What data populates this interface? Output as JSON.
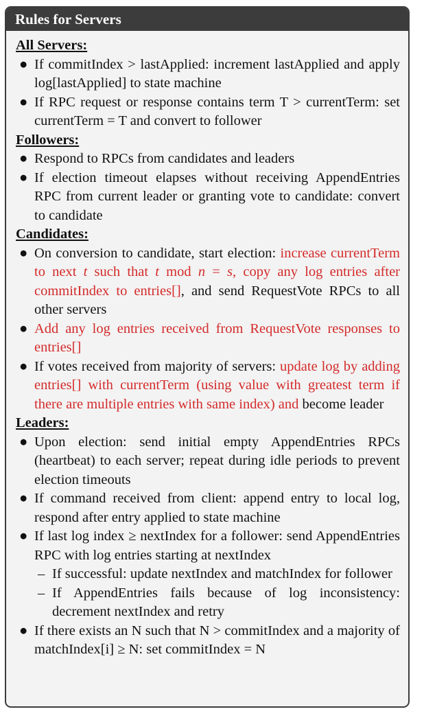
{
  "title": "Rules for Servers",
  "colors": {
    "header_bg": "#3c3c3c",
    "panel_bg": "#f3f3f3",
    "highlight": "#d42a2a"
  },
  "sections": [
    {
      "heading": "All Servers:",
      "items": [
        {
          "text": "If commitIndex > lastApplied: increment lastApplied and apply log[lastApplied] to state machine"
        },
        {
          "text": "If RPC request or response contains term T > currentTerm: set currentTerm = T and convert to follower"
        }
      ]
    },
    {
      "heading": "Followers:",
      "items": [
        {
          "text": "Respond to RPCs from candidates and leaders"
        },
        {
          "text": "If election timeout elapses without receiving AppendEntries RPC from current leader or granting vote to candidate: convert to candidate"
        }
      ]
    },
    {
      "heading": "Candidates:",
      "items": [
        {
          "text_a": "On conversion to candidate, start election: ",
          "red_a": "increase currentTerm to next ",
          "var_t1": "t",
          "red_b": " such that ",
          "var_t2": "t",
          "red_c": " mod ",
          "var_n": "n",
          "red_d": " = ",
          "var_s": "s",
          "red_e": ", copy any log entries after commitIndex to entries[]",
          "text_b": ", and send RequestVote RPCs to all other servers"
        },
        {
          "red": "Add any log entries received from RequestVote responses to entries[]"
        },
        {
          "text_a": "If votes received from majority of servers: ",
          "red": "update log by adding entries[] with currentTerm (using value with greatest term if there are multiple entries with same index) and",
          "text_b": " become leader"
        }
      ]
    },
    {
      "heading": "Leaders:",
      "items": [
        {
          "text": "Upon election: send initial empty AppendEntries RPCs (heartbeat) to each server; repeat during idle periods to prevent election timeouts"
        },
        {
          "text": "If command received from client: append entry to local log, respond after entry applied to state machine"
        },
        {
          "text": "If last log index ≥ nextIndex for a follower: send AppendEntries RPC with log entries starting at nextIndex",
          "subitems": [
            {
              "text": "If successful: update nextIndex and matchIndex for follower"
            },
            {
              "text": "If AppendEntries fails because of log inconsistency: decrement nextIndex and retry"
            }
          ]
        },
        {
          "text": "If there exists an N such that N > commitIndex and a majority of matchIndex[i] ≥ N: set commitIndex = N"
        }
      ]
    }
  ],
  "glyphs": {
    "bullet": "●",
    "dash": "–"
  }
}
